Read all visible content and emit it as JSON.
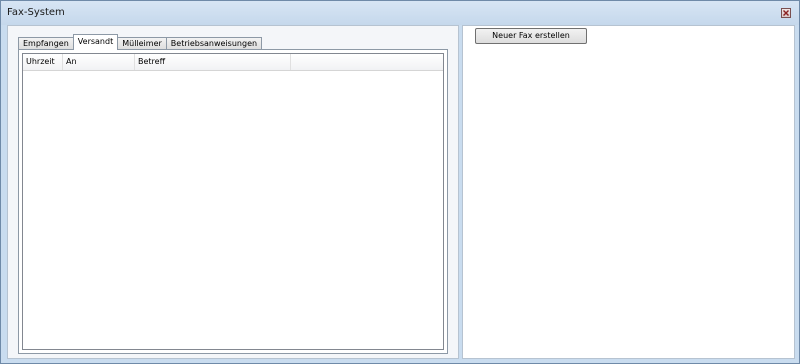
{
  "window": {
    "title": "Fax-System"
  },
  "tabs": [
    {
      "label": "Empfangen",
      "active": false
    },
    {
      "label": "Versandt",
      "active": true
    },
    {
      "label": "Mülleimer",
      "active": false
    },
    {
      "label": "Betriebsanweisungen",
      "active": false
    }
  ],
  "list": {
    "columns": [
      "Uhrzeit",
      "An",
      "Betreff"
    ],
    "rows": []
  },
  "actions": {
    "new_fax_label": "Neuer Fax erstellen"
  },
  "icons": {
    "close": "close-icon"
  },
  "colors": {
    "frame": "#c9dcef",
    "close_x": "#8a2020"
  }
}
